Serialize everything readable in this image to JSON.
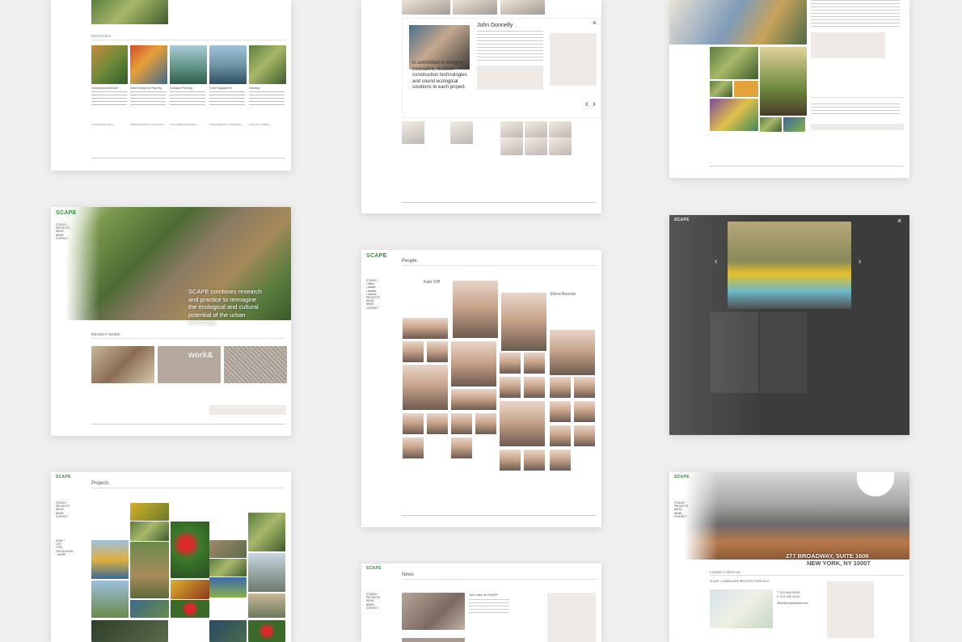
{
  "brand": {
    "logo": "SCAPE",
    "accent": "#2e8b3e"
  },
  "services": {
    "section_title": "SERVICES",
    "items": [
      {
        "label": "Landscape Architecture",
        "link": "LANDSCAPE ARCH →"
      },
      {
        "label": "Urban Design and Planning",
        "link": "URBAN DESIGN + PLANNING →"
      },
      {
        "label": "Ecological Planning",
        "link": "LIVING BREAKWATERS →"
      },
      {
        "label": "Public Engagement",
        "link": "TOWN BRANCH COMMONS →"
      },
      {
        "label": "Visioning",
        "link": "OLD MILL CREEK →"
      }
    ]
  },
  "profile": {
    "name": "John Donnelly",
    "quote": "is committed to bringing innovative, resilient construction technologies and sound ecological solutions to each project.",
    "close": "×",
    "prev": "‹",
    "next": "›"
  },
  "home": {
    "hero": "SCAPE combines research and practice to reimagine the ecological and cultural potential of the urban landscape.",
    "news_title": "RECENT NEWS",
    "nav": [
      "STUDIO +",
      "PROJECTS",
      "IDEAS",
      "NEWS",
      "CONTACT"
    ]
  },
  "people": {
    "title": "People",
    "person1": "Kate Orff",
    "person2": "Elena Brescia",
    "nav": [
      "STUDIO +",
      "• about",
      "• people",
      "• awards",
      "• careers",
      "PROJECTS",
      "IDEAS",
      "NEWS",
      "CONTACT"
    ]
  },
  "projects": {
    "title": "Projects",
    "nav": [
      "STUDIO +",
      "PROJECTS",
      "IDEAS",
      "NEWS",
      "CONTACT"
    ],
    "sort": [
      "SORT +",
      "LIST",
      "TYPE",
      "CIRCULATION",
      "+ MORE"
    ]
  },
  "news": {
    "title": "News",
    "nav": [
      "STUDIO +",
      "PROJECTS",
      "IDEAS",
      "NEWS",
      "CONTACT"
    ],
    "item_title": "Join Kate at GSAPP"
  },
  "contact": {
    "address1": "277 BROADWAY, SUITE 1606",
    "address2": "NEW YORK, NY 10007",
    "connect": "CONNECT WITH US",
    "firm": "SCAPE | LANDSCAPE ARCHITECTURE PLLC",
    "phone1": "T 212.462.2628",
    "phone2": "F 212.462.4164",
    "email": "office@scapestudio.com",
    "nav": [
      "STUDIO +",
      "PROJECTS",
      "IDEAS",
      "NEWS",
      "CONTACT"
    ]
  },
  "works_text": "work&",
  "lightbox": {
    "close": "×",
    "prev": "‹",
    "next": "›"
  }
}
